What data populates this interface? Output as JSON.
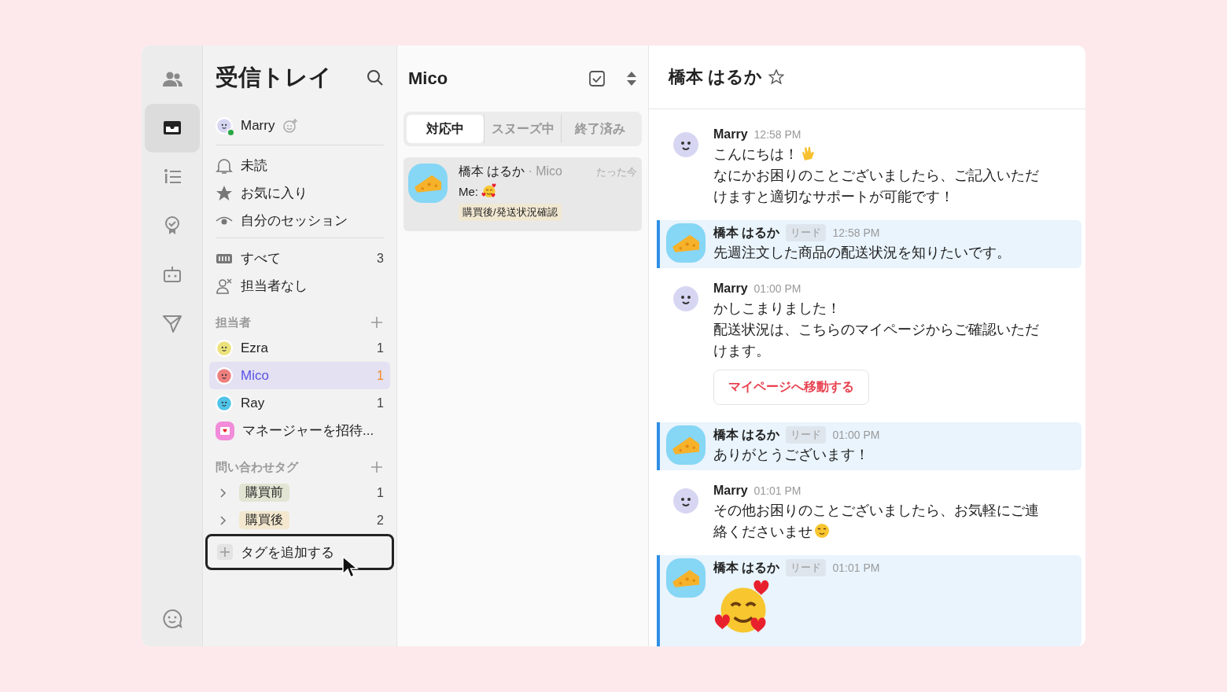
{
  "rail": {
    "items": [
      {
        "selected": false
      },
      {
        "selected": true
      },
      {
        "selected": false
      },
      {
        "selected": false
      },
      {
        "selected": false
      },
      {
        "selected": false
      }
    ]
  },
  "sidebar": {
    "title": "受信トレイ",
    "user": {
      "name": "Marry",
      "online": true
    },
    "filters": [
      {
        "label": "未読"
      },
      {
        "label": "お気に入り"
      },
      {
        "label": "自分のセッション"
      }
    ],
    "views": [
      {
        "label": "すべて",
        "count": "3"
      },
      {
        "label": "担当者なし"
      }
    ],
    "assignees": {
      "title": "担当者",
      "members": [
        {
          "name": "Ezra",
          "count": "1",
          "color": "#ece27c",
          "selected": false
        },
        {
          "name": "Mico",
          "count": "1",
          "color": "#ee7f7f",
          "selected": true
        },
        {
          "name": "Ray",
          "count": "1",
          "color": "#4fc3e8",
          "selected": false
        }
      ],
      "invite": "マネージャーを招待..."
    },
    "tags": {
      "title": "問い合わせタグ",
      "items": [
        {
          "label": "購買前",
          "count": "1",
          "color": "#e2e5d3",
          "expanded": false
        },
        {
          "label": "購買後",
          "count": "2",
          "color": "#f3e8cf",
          "expanded": false
        }
      ],
      "add_label": "タグを追加する",
      "add_highlighted": true
    }
  },
  "list": {
    "title": "Mico",
    "tabs": [
      {
        "label": "対応中",
        "selected": true
      },
      {
        "label": "スヌーズ中",
        "selected": false
      },
      {
        "label": "終了済み",
        "selected": false
      }
    ],
    "conversations": [
      {
        "name": "橋本 はるか",
        "assignee": "· Mico",
        "time": "たった今",
        "preview": "Me:",
        "preview_emoji": {
          "kind": "smiling-hearts"
        },
        "tag": "購買後/発送状況確認",
        "selected": true
      }
    ]
  },
  "chat": {
    "title": "橋本 はるか",
    "starred": false,
    "messages": [
      {
        "kind": "agent",
        "sender": "Marry",
        "time": "12:58 PM",
        "lines": [
          {
            "text": "こんにちは！",
            "emoji": {
              "kind": "wave"
            }
          },
          {
            "text": "なにかお困りのことございましたら、ご記入いただけますと適切なサポートが可能です！"
          }
        ]
      },
      {
        "kind": "customer",
        "sender": "橋本 はるか",
        "badge": "リード",
        "time": "12:58 PM",
        "lines": [
          {
            "text": "先週注文した商品の配送状況を知りたいです。"
          }
        ]
      },
      {
        "kind": "agent",
        "sender": "Marry",
        "time": "01:00 PM",
        "lines": [
          {
            "text": "かしこまりました！"
          },
          {
            "text": "配送状況は、こちらのマイページからご確認いただけます。"
          }
        ],
        "button": "マイページへ移動する"
      },
      {
        "kind": "customer",
        "sender": "橋本 はるか",
        "badge": "リード",
        "time": "01:00 PM",
        "lines": [
          {
            "text": "ありがとうございます！"
          }
        ]
      },
      {
        "kind": "agent",
        "sender": "Marry",
        "time": "01:01 PM",
        "lines": [
          {
            "text": "その他お困りのことございましたら、お気軽にご連絡くださいませ",
            "emoji": {
              "kind": "smiling"
            }
          }
        ]
      },
      {
        "kind": "customer",
        "sender": "橋本 はるか",
        "badge": "リード",
        "time": "01:01 PM",
        "sticker": {
          "kind": "smiling-hearts"
        }
      }
    ]
  }
}
